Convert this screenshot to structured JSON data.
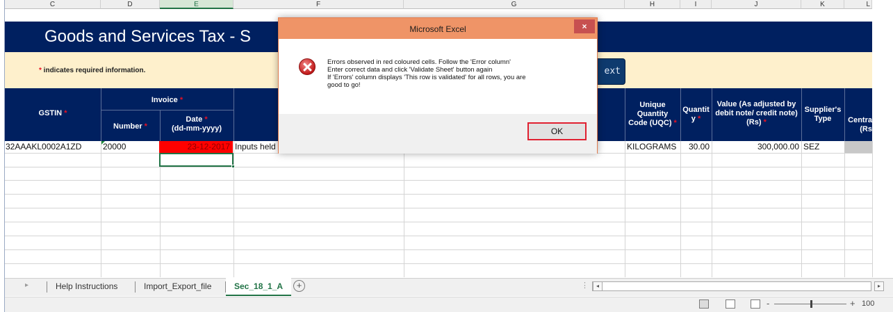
{
  "column_headers": [
    "C",
    "D",
    "E",
    "F",
    "G",
    "H",
    "I",
    "J",
    "K",
    "L"
  ],
  "banner": {
    "title": "Goods and Services Tax - S",
    "required_note_star": "*",
    "required_note": " indicates required information.",
    "button_text": "ext"
  },
  "table_header": {
    "gstin": "GSTIN",
    "invoice": "Invoice",
    "number": "Number",
    "date": "Date",
    "date_format": "(dd-mm-yyyy)",
    "uqc_l1": "Unique",
    "uqc_l2": "Quantity",
    "uqc_l3": "Code (UQC)",
    "qty_l1": "Quantit",
    "qty_l2": "y",
    "value_l1": "Value (As adjusted by",
    "value_l2": "debit note/ credit note)",
    "value_l3": "(Rs)",
    "supplier_l1": "Supplier's",
    "supplier_l2": "Type",
    "central_l1": "Centra",
    "central_l2": "(Rs",
    "star": "*"
  },
  "row": {
    "gstin": "32AAAKL0002A1ZD",
    "number": "20000",
    "date": "23-12-2017",
    "description": "Inputs held",
    "uqc": "KILOGRAMS",
    "quantity": "30.00",
    "value": "300,000.00",
    "supplier_type": "SEZ"
  },
  "dialog": {
    "title": "Microsoft Excel",
    "close": "×",
    "line1": "Errors observed in red coloured cells.  Follow the 'Error column'",
    "line2": "Enter correct data and click 'Validate Sheet' button again",
    "line3": " If 'Errors' column displays 'This row is validated' for all rows, you are",
    "line4": "good to go!",
    "ok": "OK"
  },
  "sheet_tabs": {
    "tabs": [
      "Help Instructions",
      "Import_Export_file",
      "Sec_18_1_A"
    ],
    "active": "Sec_18_1_A",
    "add": "+"
  },
  "status_bar": {
    "zoom_minus": "-",
    "zoom_plus": "+",
    "zoom": "100"
  }
}
